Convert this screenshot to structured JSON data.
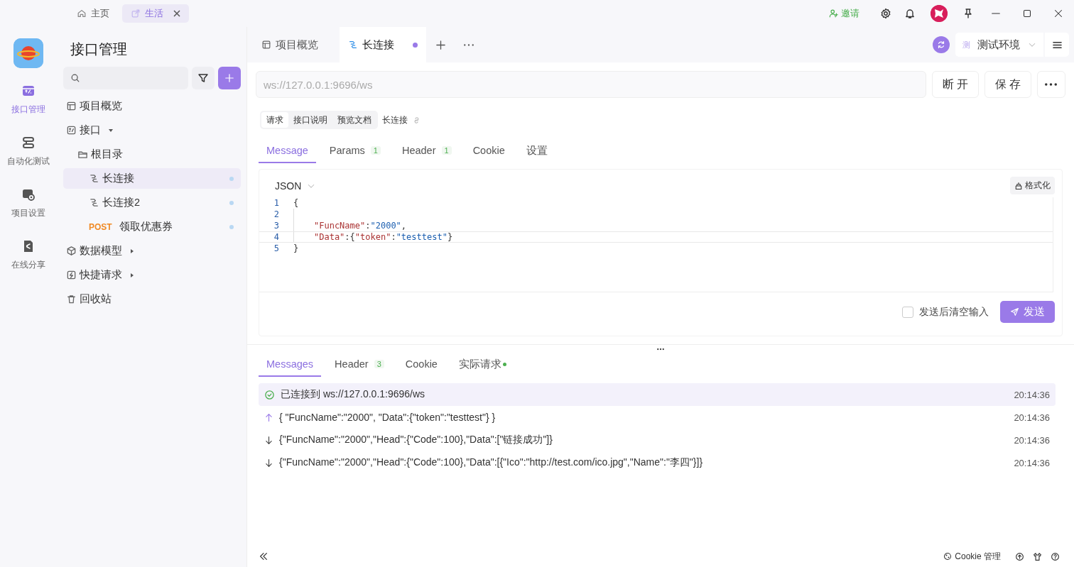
{
  "title_bar": {
    "tabs": [
      {
        "label": "主页",
        "kind": "home",
        "selected": false,
        "closable": false
      },
      {
        "label": "生活",
        "kind": "link",
        "selected": true,
        "closable": true
      }
    ],
    "invite": "邀请"
  },
  "rail": {
    "items": [
      {
        "label": "接口管理",
        "kind": "api",
        "selected": true
      },
      {
        "label": "自动化测试",
        "kind": "auto",
        "selected": false
      },
      {
        "label": "项目设置",
        "kind": "settings",
        "selected": false
      },
      {
        "label": "在线分享",
        "kind": "share",
        "selected": false
      }
    ]
  },
  "sidebar": {
    "title": "接口管理",
    "tree": [
      {
        "label": "项目概览",
        "kind": "overview",
        "selected": false
      },
      {
        "label": "接口",
        "kind": "api",
        "selected": false,
        "expanded": true,
        "children": [
          {
            "label": "根目录",
            "kind": "folder",
            "selected": false,
            "children": [
              {
                "label": "长连接",
                "kind": "ws",
                "selected": true
              },
              {
                "label": "长连接2",
                "kind": "ws",
                "selected": false
              },
              {
                "label": "领取优惠券",
                "kind": "http",
                "method": "POST",
                "selected": false
              }
            ]
          }
        ]
      },
      {
        "label": "数据模型",
        "kind": "model",
        "selected": false,
        "expanded": false
      },
      {
        "label": "快捷请求",
        "kind": "quick",
        "selected": false,
        "expanded": false
      },
      {
        "label": "回收站",
        "kind": "trash",
        "selected": false
      }
    ]
  },
  "doc_tabs": [
    {
      "label": "项目概览",
      "kind": "overview",
      "selected": false,
      "unsaved": false
    },
    {
      "label": "长连接",
      "kind": "ws",
      "selected": true,
      "unsaved": true
    }
  ],
  "environment": {
    "badge": "测",
    "label": "测试环境"
  },
  "url_bar": {
    "value": "ws://127.0.0.1:9696/ws",
    "buttons": [
      "断 开",
      "保 存"
    ]
  },
  "mode_tabs": [
    {
      "label": "请求",
      "selected": true
    },
    {
      "label": "接口说明",
      "selected": false
    },
    {
      "label": "预览文档",
      "selected": false
    }
  ],
  "api_name": "长连接",
  "request_tabs": [
    {
      "label": "Message",
      "selected": true
    },
    {
      "label": "Params",
      "count": "1",
      "selected": false
    },
    {
      "label": "Header",
      "count": "1",
      "selected": false
    },
    {
      "label": "Cookie",
      "selected": false
    },
    {
      "label": "设置",
      "selected": false
    }
  ],
  "editor": {
    "format": "JSON",
    "format_button": "格式化",
    "lines": [
      {
        "number": "1",
        "indented": false,
        "current": false,
        "tokens": [
          {
            "kind": "punct",
            "text": "{"
          }
        ]
      },
      {
        "number": "2",
        "indented": true,
        "current": false
      },
      {
        "number": "3",
        "indented": true,
        "current": false,
        "tokens": [
          {
            "kind": "key",
            "text": "\"FuncName\""
          },
          {
            "kind": "punct",
            "text": ":"
          },
          {
            "kind": "string",
            "text": "\"2000\""
          },
          {
            "kind": "punct",
            "text": ","
          }
        ]
      },
      {
        "number": "4",
        "indented": true,
        "current": true,
        "tokens": [
          {
            "kind": "key",
            "text": "\"Data\""
          },
          {
            "kind": "punct",
            "text": ":{"
          },
          {
            "kind": "key",
            "text": "\"token\""
          },
          {
            "kind": "punct",
            "text": ":"
          },
          {
            "kind": "string",
            "text": "\"testtest\""
          },
          {
            "kind": "punct",
            "text": "}"
          }
        ]
      },
      {
        "number": "5",
        "indented": false,
        "current": false,
        "tokens": [
          {
            "kind": "punct",
            "text": "}"
          }
        ]
      }
    ],
    "clear_after_send": {
      "label": "发送后清空输入",
      "checked": false
    },
    "send": "发送"
  },
  "response_tabs": [
    {
      "label": "Messages",
      "selected": true,
      "dot": false
    },
    {
      "label": "Header",
      "count": "3",
      "selected": false,
      "dot": false
    },
    {
      "label": "Cookie",
      "selected": false,
      "dot": false
    },
    {
      "label": "实际请求",
      "selected": false,
      "dot": true
    }
  ],
  "messages": [
    {
      "kind": "connected",
      "text": "已连接到 ws://127.0.0.1:9696/ws",
      "time": "20:14:36"
    },
    {
      "kind": "sent",
      "text": "{ \"FuncName\":\"2000\", \"Data\":{\"token\":\"testtest\"} }",
      "time": "20:14:36"
    },
    {
      "kind": "received",
      "text": "{\"FuncName\":\"2000\",\"Head\":{\"Code\":100},\"Data\":[\"链接成功\"]}",
      "time": "20:14:36"
    },
    {
      "kind": "received",
      "text": "{\"FuncName\":\"2000\",\"Head\":{\"Code\":100},\"Data\":[{\"Ico\":\"http://test.com/ico.jpg\",\"Name\":\"李四\"}]}",
      "time": "20:14:36"
    }
  ],
  "status_bar": {
    "cookie": "Cookie 管理"
  }
}
